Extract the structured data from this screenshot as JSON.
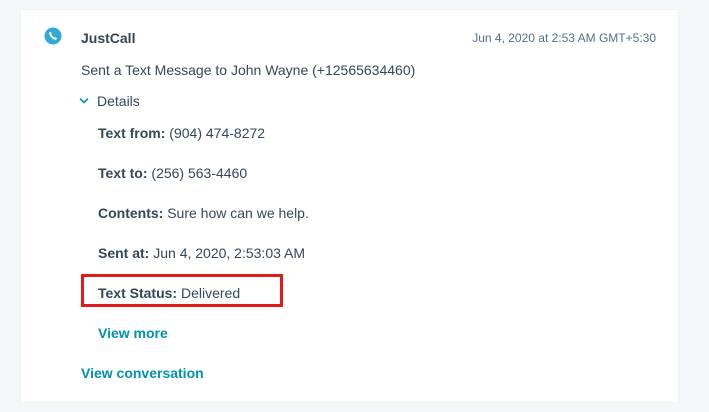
{
  "activity": {
    "app_name": "JustCall",
    "timestamp": "Jun 4, 2020 at 2:53 AM GMT+5:30",
    "summary": "Sent a Text Message to John Wayne (+12565634460)",
    "details_label": "Details",
    "details": [
      {
        "key": "Text from:",
        "value": " (904) 474-8272"
      },
      {
        "key": "Text to:",
        "value": " (256) 563-4460"
      },
      {
        "key": "Contents:",
        "value": " Sure how can we help."
      },
      {
        "key": "Sent at:",
        "value": " Jun 4, 2020, 2:53:03 AM"
      },
      {
        "key": "Text Status:",
        "value": " Delivered"
      }
    ],
    "view_more": "View more",
    "view_conversation": "View conversation"
  },
  "icons": {
    "logo": "justcall-phone-icon",
    "chevron": "chevron-down-icon"
  },
  "colors": {
    "link": "#0091ae",
    "text": "#33475b",
    "highlight": "#e21a1a",
    "logo": "#2fa9d8"
  }
}
